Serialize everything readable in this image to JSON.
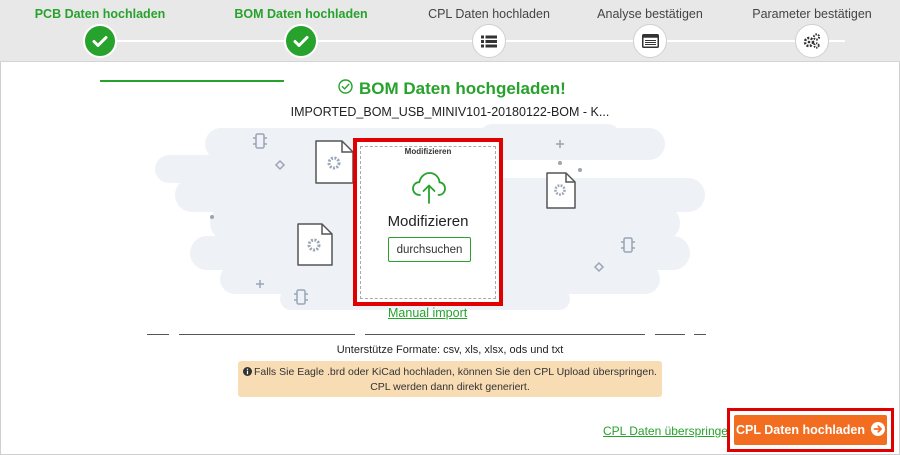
{
  "steps": [
    {
      "label": "PCB Daten hochladen",
      "state": "done",
      "icon": "check-icon"
    },
    {
      "label": "BOM Daten hochladen",
      "state": "done",
      "icon": "check-icon"
    },
    {
      "label": "CPL Daten hochladen",
      "state": "todo",
      "icon": "list-icon"
    },
    {
      "label": "Analyse bestätigen",
      "state": "todo",
      "icon": "window-icon"
    },
    {
      "label": "Parameter bestätigen",
      "state": "todo",
      "icon": "gears-icon"
    }
  ],
  "header": {
    "title": "BOM Daten hochgeladen!",
    "filename": "IMPORTED_BOM_USB_MINIV101-20180122-BOM - K..."
  },
  "upload": {
    "tag": "Modifizieren",
    "title": "Modifizieren",
    "browse_label": "durchsuchen"
  },
  "manual_import": "Manual import",
  "formats": "Unterstütze Formate: csv, xls, xlsx, ods und txt",
  "info": {
    "line1": "Falls Sie Eagle .brd oder KiCad hochladen, können Sie den CPL Upload überspringen.",
    "line2": "CPL werden dann direkt generiert."
  },
  "actions": {
    "skip_label": "CPL Daten überspringen",
    "next_label": "CPL Daten hochladen"
  },
  "colors": {
    "accent": "#27a22c",
    "primary_button": "#f36d21",
    "highlight": "#e00000",
    "info_bg": "#f8dcb4"
  }
}
